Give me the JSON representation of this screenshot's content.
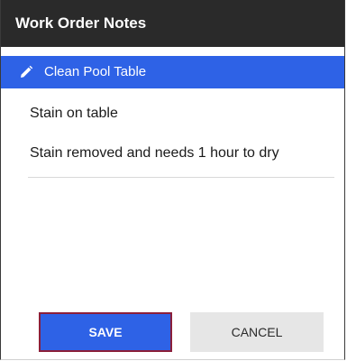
{
  "dialog": {
    "title": "Work Order Notes"
  },
  "task": {
    "icon": "pencil-icon",
    "label": "Clean Pool Table"
  },
  "notes": [
    "Stain on table",
    "Stain removed and needs 1 hour to dry"
  ],
  "buttons": {
    "save_label": "SAVE",
    "cancel_label": "CANCEL"
  },
  "colors": {
    "title_bar": "#2a2a2a",
    "accent": "#2e62e6",
    "save_border": "#8b1f3a",
    "cancel_bg": "#e6e6e6"
  }
}
